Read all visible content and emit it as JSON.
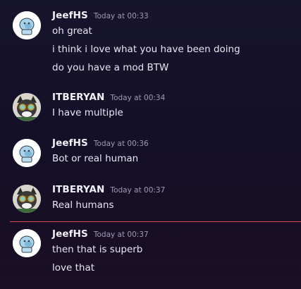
{
  "messages": [
    {
      "username": "JeefHS",
      "timestamp": "Today at 00:33",
      "avatar_icon": "blue-creature-avatar",
      "lines": [
        "oh great",
        "i think i love what you have been doing",
        "do you have a mod BTW"
      ]
    },
    {
      "username": "ITBERYAN",
      "timestamp": "Today at 00:34",
      "avatar_icon": "goggles-cat-avatar",
      "lines": [
        "I have multiple"
      ]
    },
    {
      "username": "JeefHS",
      "timestamp": "Today at 00:36",
      "avatar_icon": "blue-creature-avatar",
      "lines": [
        "Bot or real human"
      ]
    },
    {
      "username": "ITBERYAN",
      "timestamp": "Today at 00:37",
      "avatar_icon": "goggles-cat-avatar",
      "lines": [
        "Real humans"
      ]
    },
    {
      "username": "JeefHS",
      "timestamp": "Today at 00:37",
      "avatar_icon": "blue-creature-avatar",
      "lines": [
        "then that is superb",
        "love that"
      ]
    }
  ],
  "colors": {
    "background_top": "#17142d",
    "background_bottom": "#1a0f25",
    "new_messages_divider": "#d9464a",
    "username": "#f2f0f8",
    "timestamp": "#9e9bb3"
  }
}
